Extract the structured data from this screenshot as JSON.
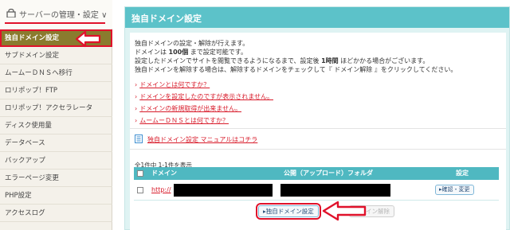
{
  "sidebar": {
    "header": "サーバーの管理・設定",
    "header_chevron": "∨",
    "items": [
      {
        "label": "独自ドメイン設定"
      },
      {
        "label": "サブドメイン設定"
      },
      {
        "label": "ムームーＤＮＳへ移行"
      },
      {
        "label": "ロリポップ！FTP"
      },
      {
        "label": "ロリポップ！アクセラレータ"
      },
      {
        "label": "ディスク使用量"
      },
      {
        "label": "データベース"
      },
      {
        "label": "バックアップ"
      },
      {
        "label": "エラーページ変更"
      },
      {
        "label": "PHP設定"
      },
      {
        "label": "アクセスログ"
      }
    ]
  },
  "main": {
    "title": "独自ドメイン設定",
    "desc1": "独自ドメインの設定・解除が行えます。",
    "desc2a": "ドメインは ",
    "desc2b": "100個",
    "desc2c": " まで設定可能です。",
    "desc3a": "設定したドメインでサイトを閲覧できるようになるまで、設定後 ",
    "desc3b": "1時間",
    "desc3c": " ほどかかる場合がございます。",
    "desc4": "独自ドメインを解除する場合は、解除するドメインをチェックして『 ドメイン解除 』をクリックしてください。",
    "links": [
      "ドメインとは何ですか？",
      "ドメインを設定したのですが表示されません。",
      "ドメインの新規取得が出来ません。",
      "ムームーＤＮＳとは何ですか？"
    ],
    "link_bullet": "›",
    "manual": "独自ドメイン設定 マニュアルはコチラ",
    "count": "全1件中 1-1件を表示",
    "table": {
      "headers": {
        "domain": "ドメイン",
        "folder": "公開（アップロード）フォルダ",
        "settings": "設定"
      },
      "rows": [
        {
          "domain_prefix": "http://",
          "settings_button": "確認・変更"
        }
      ]
    },
    "add_button": "独自ドメイン設定",
    "delete_button": "ドメイン解除"
  }
}
